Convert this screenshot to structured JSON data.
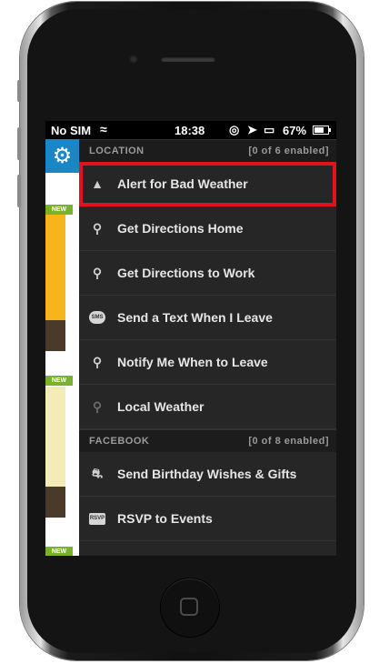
{
  "status_bar": {
    "carrier": "No SIM",
    "wifi_icon": "wifi-icon",
    "time": "18:38",
    "battery": "67%"
  },
  "sidebar": {
    "settings_icon": "gear-icon",
    "badge_new": "NEW"
  },
  "sections": [
    {
      "title": "LOCATION",
      "count": "[0 of 6 enabled]",
      "items": [
        {
          "label": "Alert for Bad Weather",
          "icon": "warning-icon"
        },
        {
          "label": "Get Directions Home",
          "icon": "map-pin-icon"
        },
        {
          "label": "Get Directions to Work",
          "icon": "map-pin-icon"
        },
        {
          "label": "Send a Text When I Leave",
          "icon": "sms-bubble-icon"
        },
        {
          "label": "Notify Me When to Leave",
          "icon": "map-pin-icon"
        },
        {
          "label": "Local Weather",
          "icon": "search-icon"
        }
      ]
    },
    {
      "title": "FACEBOOK",
      "count": "[0 of 8 enabled]",
      "items": [
        {
          "label": "Send Birthday Wishes & Gifts",
          "icon": "gift-icon"
        },
        {
          "label": "RSVP to Events",
          "icon": "rsvp-icon"
        }
      ]
    }
  ],
  "icon_text": {
    "sms": "SMS",
    "rsvp": "RSVP"
  },
  "colors": {
    "highlight": "#e5121b",
    "accent": "#1a86c6",
    "new_badge": "#7ab230"
  }
}
